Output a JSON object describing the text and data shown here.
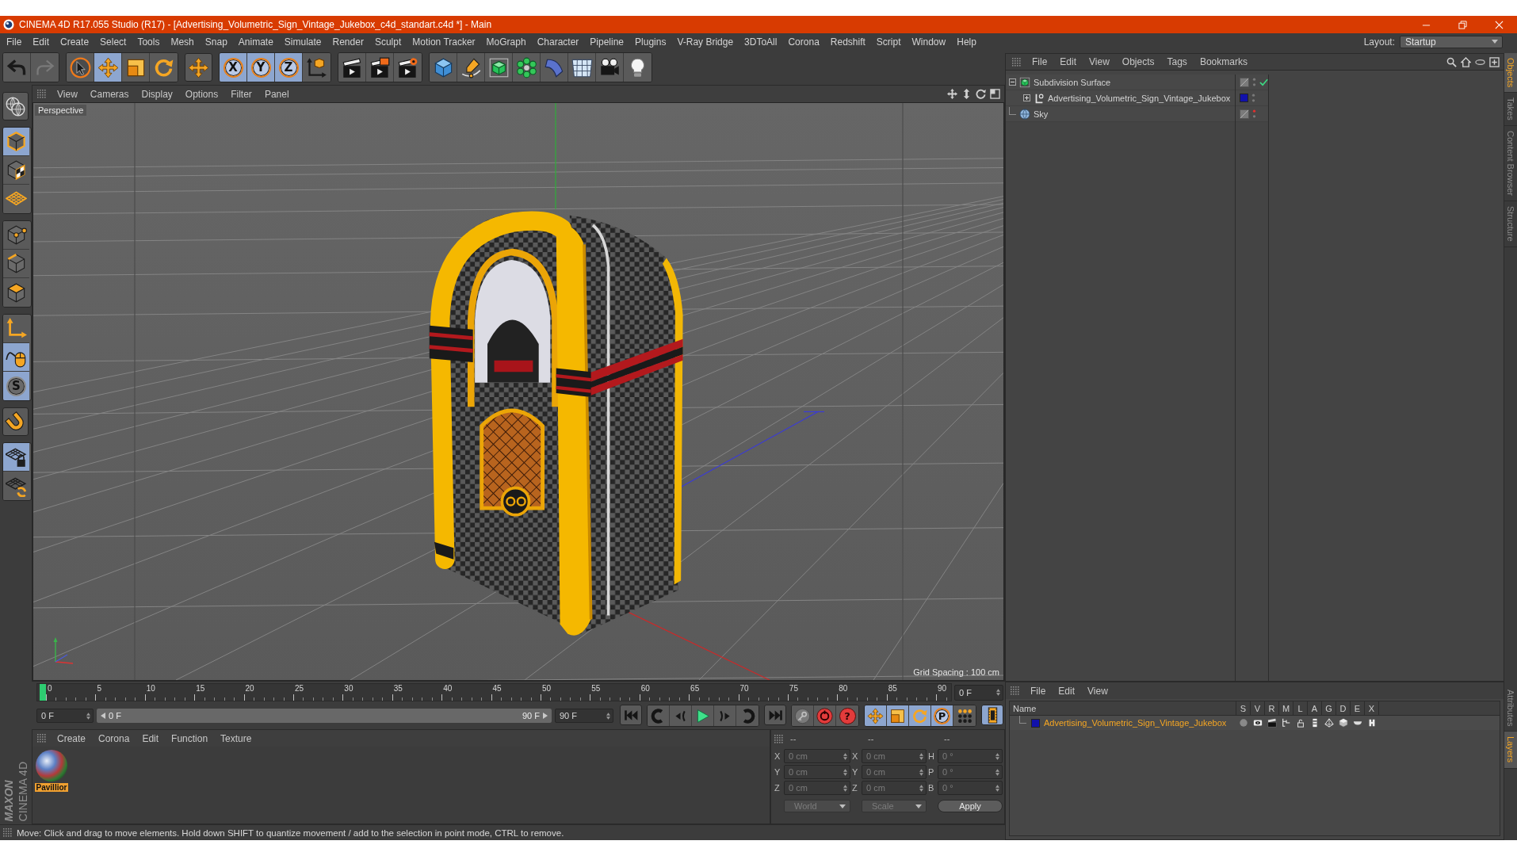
{
  "window": {
    "title": "CINEMA 4D R17.055 Studio (R17) - [Advertising_Volumetric_Sign_Vintage_Jukebox_c4d_standart.c4d *] - Main"
  },
  "menu_bar": {
    "items": [
      "File",
      "Edit",
      "Create",
      "Select",
      "Tools",
      "Mesh",
      "Snap",
      "Animate",
      "Simulate",
      "Render",
      "Sculpt",
      "Motion Tracker",
      "MoGraph",
      "Character",
      "Pipeline",
      "Plugins",
      "V-Ray Bridge",
      "3DToAll",
      "Corona",
      "Redshift",
      "Script",
      "Window",
      "Help"
    ],
    "layout_label": "Layout:",
    "layout_value": "Startup"
  },
  "toolbar": {
    "groups": [
      [
        {
          "kind": "undo",
          "on": false
        },
        {
          "kind": "redo",
          "on": false
        }
      ],
      [
        {
          "kind": "select",
          "on": false
        },
        {
          "kind": "move",
          "on": true
        },
        {
          "kind": "scale",
          "on": false
        },
        {
          "kind": "rotate",
          "on": false
        }
      ],
      [
        {
          "kind": "last_tool",
          "on": false
        }
      ],
      [
        {
          "kind": "axis",
          "label": "X",
          "on": true
        },
        {
          "kind": "axis",
          "label": "Y",
          "on": true
        },
        {
          "kind": "axis",
          "label": "Z",
          "on": true
        },
        {
          "kind": "coordinates",
          "on": false
        }
      ],
      [
        {
          "kind": "render_view",
          "on": false
        },
        {
          "kind": "render_picture",
          "on": false
        },
        {
          "kind": "render_settings",
          "on": false
        }
      ],
      [
        {
          "kind": "cube",
          "on": false
        },
        {
          "kind": "pen",
          "on": false
        },
        {
          "kind": "subdivision",
          "on": false
        },
        {
          "kind": "cloner",
          "on": false
        },
        {
          "kind": "bend",
          "on": false
        },
        {
          "kind": "floor",
          "on": false
        },
        {
          "kind": "camera",
          "on": false
        },
        {
          "kind": "light",
          "on": false
        }
      ]
    ]
  },
  "left_toolbar": {
    "groups": [
      [
        {
          "kind": "make_editable",
          "on": false
        }
      ],
      [
        {
          "kind": "model",
          "on": true
        },
        {
          "kind": "texture",
          "on": false
        },
        {
          "kind": "workplane",
          "on": false
        }
      ],
      [
        {
          "kind": "points",
          "on": false
        },
        {
          "kind": "edges",
          "on": false
        },
        {
          "kind": "polygons",
          "on": false
        }
      ],
      [
        {
          "kind": "axis_mode",
          "on": false
        },
        {
          "kind": "tweak",
          "on": true
        },
        {
          "kind": "snap",
          "label": "S",
          "on": true
        }
      ],
      [
        {
          "kind": "magnet",
          "on": false
        }
      ],
      [
        {
          "kind": "lock_workplane",
          "on": true
        },
        {
          "kind": "workplane_align",
          "on": false
        }
      ]
    ]
  },
  "viewport": {
    "menu": [
      "View",
      "Cameras",
      "Display",
      "Options",
      "Filter",
      "Panel"
    ],
    "camera": "Perspective",
    "grid_spacing": "Grid Spacing : 100 cm"
  },
  "timeline": {
    "ticks": [
      "0",
      "5",
      "10",
      "15",
      "20",
      "25",
      "30",
      "35",
      "40",
      "45",
      "50",
      "55",
      "60",
      "65",
      "70",
      "75",
      "80",
      "85",
      "90"
    ],
    "level": 0,
    "current_frame": "0 F",
    "start_frame": "0 F",
    "range": {
      "start": "0 F",
      "end": "90 F",
      "level": 1
    },
    "end_frame": "90 F"
  },
  "transport": {
    "groups": [
      [
        {
          "kind": "go_start",
          "on": false
        }
      ],
      [
        {
          "kind": "prev_key",
          "on": false
        },
        {
          "kind": "prev_frame",
          "on": false
        },
        {
          "kind": "play",
          "on": false
        },
        {
          "kind": "next_frame",
          "on": false
        },
        {
          "kind": "next_key",
          "on": false
        }
      ],
      [
        {
          "kind": "go_end",
          "on": false
        }
      ],
      [
        {
          "kind": "record_keys",
          "on": false
        },
        {
          "kind": "autokey",
          "on": false
        },
        {
          "kind": "key_selection",
          "label": "?",
          "on": false
        }
      ],
      [
        {
          "kind": "key_position",
          "on": true
        },
        {
          "kind": "key_scale",
          "on": true
        },
        {
          "kind": "key_rotation",
          "on": true
        },
        {
          "kind": "key_parameter",
          "label": "P",
          "on": true
        },
        {
          "kind": "key_points",
          "on": false
        }
      ],
      [
        {
          "kind": "timeline",
          "on": true
        }
      ]
    ]
  },
  "material_manager": {
    "menu": [
      "Create",
      "Corona",
      "Edit",
      "Function",
      "Texture"
    ],
    "materials": [
      {
        "name": "Pavillior",
        "selected": true
      }
    ]
  },
  "logo": {
    "brand": "MAXON",
    "product": "CINEMA 4D"
  },
  "coordinates": {
    "disabled": true,
    "headers": [
      "--",
      "--",
      "--"
    ],
    "rows": [
      {
        "position_axis": "X",
        "position": "0 cm",
        "size_axis": "X",
        "size": "0 cm",
        "rotation_axis": "H",
        "rotation": "0 °"
      },
      {
        "position_axis": "Y",
        "position": "0 cm",
        "size_axis": "Y",
        "size": "0 cm",
        "rotation_axis": "P",
        "rotation": "0 °"
      },
      {
        "position_axis": "Z",
        "position": "0 cm",
        "size_axis": "Z",
        "size": "0 cm",
        "rotation_axis": "B",
        "rotation": "0 °"
      }
    ],
    "mode": "World",
    "transform_mode": "Scale",
    "apply": "Apply"
  },
  "status_bar": {
    "text": "Move: Click and drag to move elements. Hold down SHIFT to quantize movement / add to the selection in point mode, CTRL to remove."
  },
  "object_manager": {
    "menu": [
      "File",
      "Edit",
      "View",
      "Objects",
      "Tags",
      "Bookmarks"
    ],
    "objects": [
      {
        "kind": "subdivision",
        "name": "Subdivision Surface",
        "expanded": true,
        "hidden_in_editor": false,
        "enabled": true,
        "children": [
          {
            "kind": "null",
            "name": "Advertising_Volumetric_Sign_Vintage_Jukebox",
            "expanded": false,
            "hidden_in_editor": false,
            "color": "#1111aa"
          }
        ]
      },
      {
        "kind": "sky",
        "name": "Sky",
        "hidden_in_editor": true
      }
    ]
  },
  "layer_manager": {
    "menu": [
      "File",
      "Edit",
      "View"
    ],
    "columns": [
      "Name",
      "S",
      "V",
      "R",
      "M",
      "L",
      "A",
      "G",
      "D",
      "E",
      "X"
    ],
    "layers": [
      {
        "name": "Advertising_Volumetric_Sign_Vintage_Jukebox",
        "color": "#1111aa"
      }
    ]
  },
  "side_tabs": {
    "upper": [
      {
        "label": "Objects",
        "selected": true
      },
      {
        "label": "Takes",
        "selected": false
      },
      {
        "label": "Content Browser",
        "selected": false
      },
      {
        "label": "Structure",
        "selected": false
      }
    ],
    "lower": [
      {
        "label": "Attributes",
        "selected": false
      },
      {
        "label": "Layers",
        "selected": true
      }
    ]
  }
}
